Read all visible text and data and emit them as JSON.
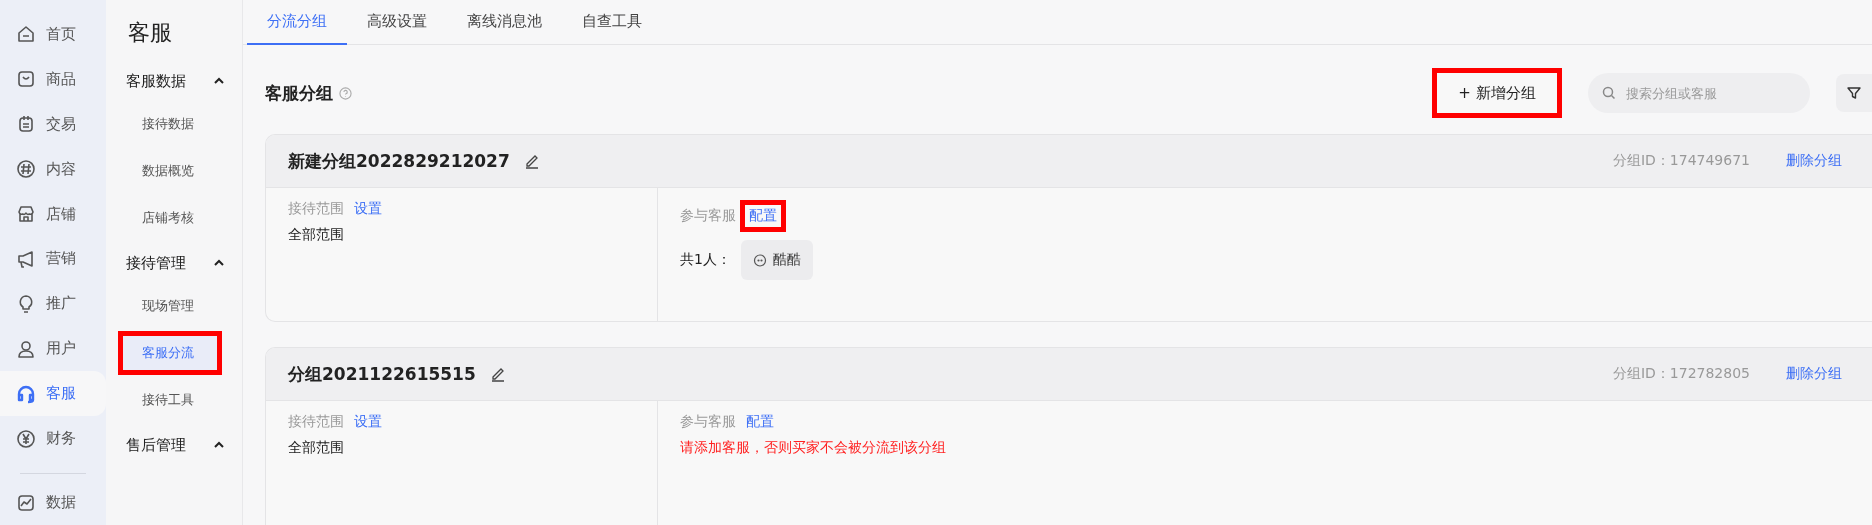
{
  "rail": {
    "items": [
      {
        "label": "首页",
        "selected": false
      },
      {
        "label": "商品",
        "selected": false
      },
      {
        "label": "交易",
        "selected": false
      },
      {
        "label": "内容",
        "selected": false
      },
      {
        "label": "店铺",
        "selected": false
      },
      {
        "label": "营销",
        "selected": false
      },
      {
        "label": "推广",
        "selected": false
      },
      {
        "label": "用户",
        "selected": false
      },
      {
        "label": "客服",
        "selected": true
      },
      {
        "label": "财务",
        "selected": false
      },
      {
        "label": "数据",
        "selected": false
      }
    ]
  },
  "subnav": {
    "title": "客服",
    "sections": [
      {
        "label": "客服数据",
        "expanded": true,
        "items": [
          {
            "label": "接待数据",
            "selected": false,
            "highlighted": false
          },
          {
            "label": "数据概览",
            "selected": false,
            "highlighted": false
          },
          {
            "label": "店铺考核",
            "selected": false,
            "highlighted": false
          }
        ]
      },
      {
        "label": "接待管理",
        "expanded": true,
        "items": [
          {
            "label": "现场管理",
            "selected": false,
            "highlighted": false
          },
          {
            "label": "客服分流",
            "selected": true,
            "highlighted": true
          },
          {
            "label": "接待工具",
            "selected": false,
            "highlighted": false
          }
        ]
      },
      {
        "label": "售后管理",
        "expanded": true
      }
    ]
  },
  "tabs": [
    {
      "label": "分流分组",
      "selected": true
    },
    {
      "label": "高级设置",
      "selected": false
    },
    {
      "label": "离线消息池",
      "selected": false
    },
    {
      "label": "自查工具",
      "selected": false
    }
  ],
  "heading": "客服分组",
  "new_group_button": {
    "label": "+ 新增分组",
    "highlighted": true
  },
  "search": {
    "placeholder": "搜索分组或客服"
  },
  "groups": [
    {
      "name": "新建分组2022829212027",
      "id_label": "分组ID：174749671",
      "delete_label": "删除分组",
      "scope_label": "接待范围",
      "scope_link": "设置",
      "scope_value": "全部范围",
      "agents_label": "参与客服",
      "agents_link": "配置",
      "agents_link_highlighted": true,
      "agent_count": "共1人：",
      "agents": [
        "酷酷"
      ]
    },
    {
      "name": "分组2021122615515",
      "id_label": "分组ID：172782805",
      "delete_label": "删除分组",
      "scope_label": "接待范围",
      "scope_link": "设置",
      "scope_value": "全部范围",
      "agents_label": "参与客服",
      "agents_link": "配置",
      "agents_link_highlighted": false,
      "warning": "请添加客服，否则买家不会被分流到该分组"
    }
  ]
}
